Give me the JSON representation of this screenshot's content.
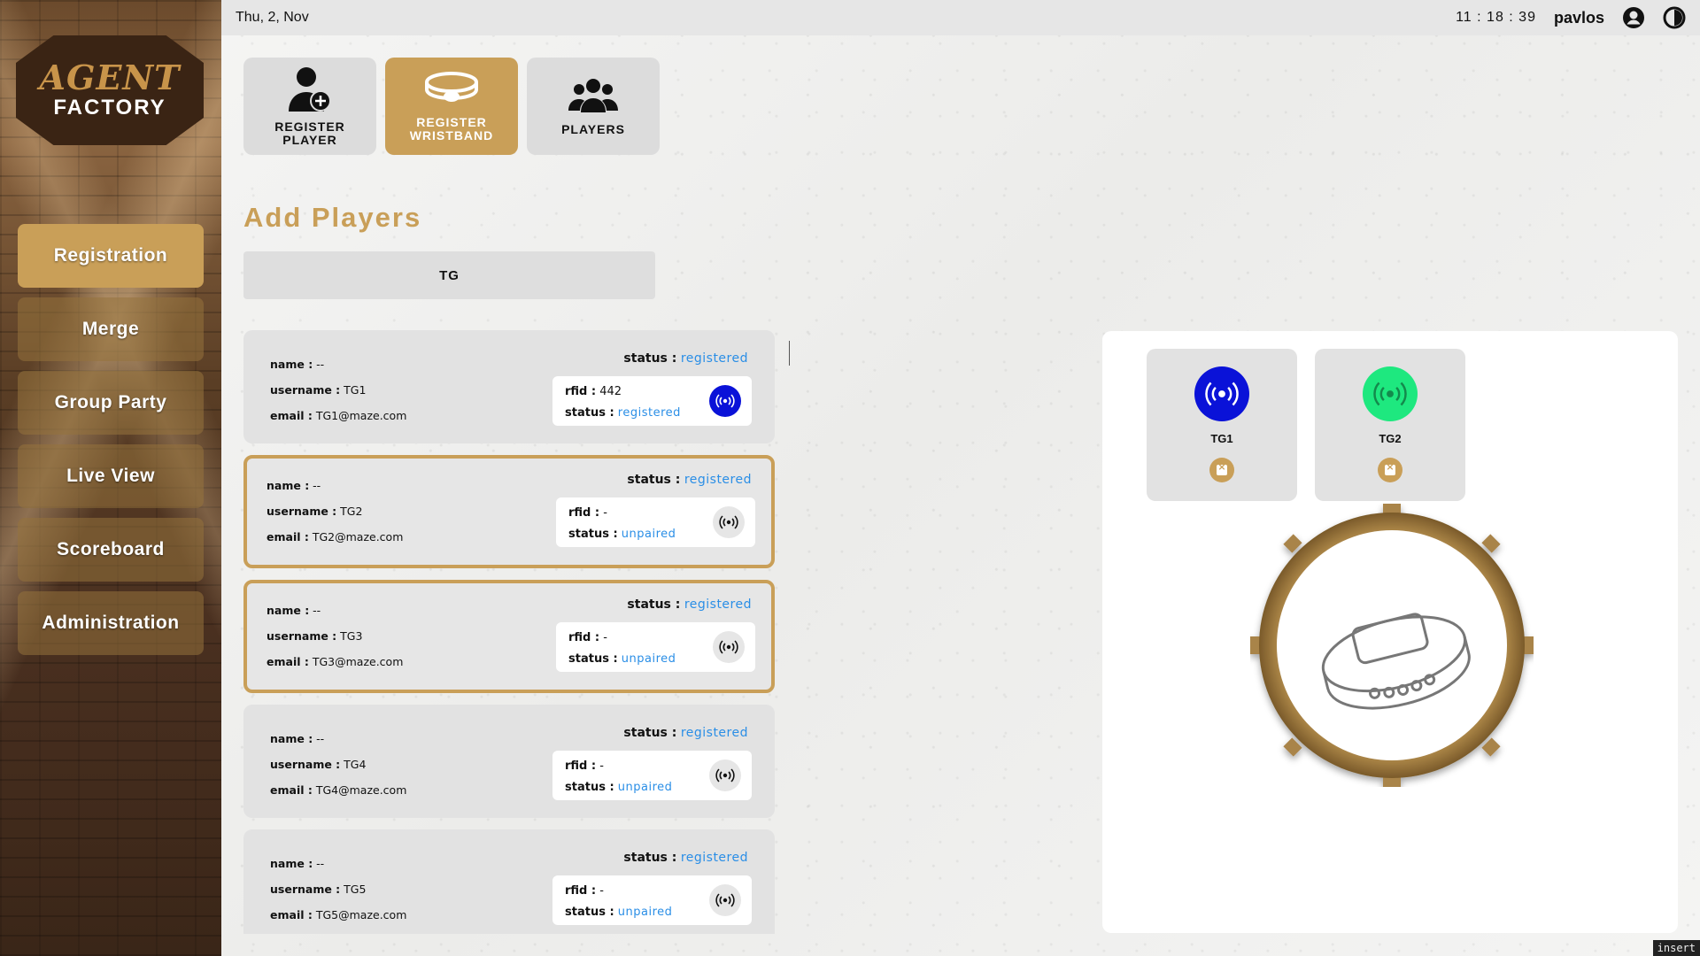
{
  "sidebar": {
    "logo_top": "AGENT",
    "logo_bottom": "FACTORY",
    "items": [
      {
        "label": "Registration"
      },
      {
        "label": "Merge"
      },
      {
        "label": "Group Party"
      },
      {
        "label": "Live View"
      },
      {
        "label": "Scoreboard"
      },
      {
        "label": "Administration"
      }
    ]
  },
  "topbar": {
    "date": "Thu, 2, Nov",
    "clock": "11 : 18 : 39",
    "username": "pavlos"
  },
  "tiles": [
    {
      "label": "REGISTER PLAYER",
      "icon": "user-plus-icon"
    },
    {
      "label": "REGISTER WRISTBAND",
      "icon": "wristband-icon"
    },
    {
      "label": "PLAYERS",
      "icon": "group-icon"
    }
  ],
  "main": {
    "title": "Add Players",
    "group": "TG"
  },
  "labels": {
    "name": "name :",
    "username": "username :",
    "email": "email :",
    "status": "status :",
    "rfid": "rfid :"
  },
  "players": [
    {
      "name": "--",
      "username": "TG1",
      "email": "TG1@maze.com",
      "status": "registered",
      "rfid": "442",
      "rfid_status": "registered"
    },
    {
      "name": "--",
      "username": "TG2",
      "email": "TG2@maze.com",
      "status": "registered",
      "rfid": "-",
      "rfid_status": "unpaired"
    },
    {
      "name": "--",
      "username": "TG3",
      "email": "TG3@maze.com",
      "status": "registered",
      "rfid": "-",
      "rfid_status": "unpaired"
    },
    {
      "name": "--",
      "username": "TG4",
      "email": "TG4@maze.com",
      "status": "registered",
      "rfid": "-",
      "rfid_status": "unpaired"
    },
    {
      "name": "--",
      "username": "TG5",
      "email": "TG5@maze.com",
      "status": "registered",
      "rfid": "-",
      "rfid_status": "unpaired"
    }
  ],
  "wristbands": [
    {
      "label": "TG1",
      "color": "#0a12d8"
    },
    {
      "label": "TG2",
      "color": "#1ee87f"
    }
  ],
  "colors": {
    "accent": "#c99f58",
    "link": "#2a8ee6",
    "linked_rfid": "#0a12d8"
  },
  "insert_mode": "insert"
}
